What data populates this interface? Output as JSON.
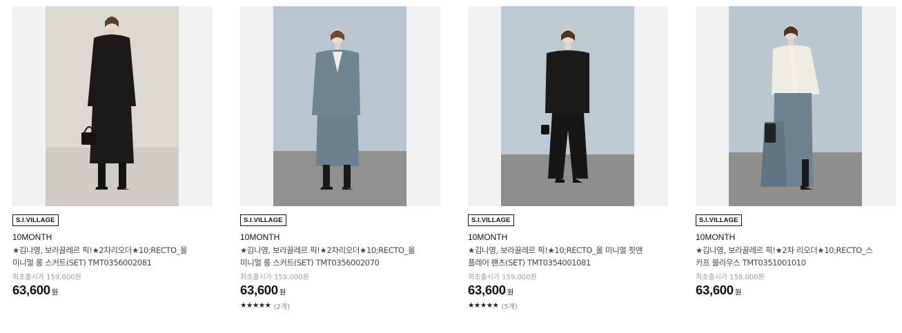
{
  "products": [
    {
      "badge": "S.I.VILLAGE",
      "brand": "10MONTH",
      "name_line1": "★김나영, 보라끌레르 픽!★2차리오더★10;RECTO_올",
      "name_line2": "미니멀 롱 스커트(SET) TMT0356002081",
      "original_price": "최초출시가 159,000원",
      "price": "63,600",
      "currency": "원",
      "stars": "",
      "review_count": "",
      "photo": {
        "bg": "#dcd8d2",
        "floor": "#cfcac3",
        "outfit": "black-jacket-skirt"
      }
    },
    {
      "badge": "S.I.VILLAGE",
      "brand": "10MONTH",
      "name_line1": "★김나영, 보라끌레르 픽!★2차리오더★10;RECTO_올",
      "name_line2": "미니멀 롱 스커트(SET) TMT0356002070",
      "original_price": "최초출시가 159,000원",
      "price": "63,600",
      "currency": "원",
      "stars": "★★★★★",
      "review_count": "(2개)",
      "photo": {
        "bg": "#b8c6cf",
        "floor": "#8e8f8e",
        "outfit": "blue-jacket-skirt"
      }
    },
    {
      "badge": "S.I.VILLAGE",
      "brand": "10MONTH",
      "name_line1": "★김나영, 보라끌레르 픽!★10;RECTO_올 미니멀 핏앤",
      "name_line2": "플레어 팬츠(SET) TMT0354001081",
      "original_price": "최초출시가 159,000원",
      "price": "63,600",
      "currency": "원",
      "stars": "★★★★★",
      "review_count": "(5개)",
      "photo": {
        "bg": "#bcc9d1",
        "floor": "#8d8e8c",
        "outfit": "black-jacket-pants"
      }
    },
    {
      "badge": "S.I.VILLAGE",
      "brand": "10MONTH",
      "name_line1": "★김나영, 보라끌레르 픽!★2차 리오더★10;RECTO_스",
      "name_line2": "카프 블라우스 TMT0351001010",
      "original_price": "최초출시가 159,000원",
      "price": "63,600",
      "currency": "원",
      "stars": "",
      "review_count": "",
      "photo": {
        "bg": "#b9c6ce",
        "floor": "#8e8e8c",
        "outfit": "white-blouse-blue-skirt"
      }
    }
  ]
}
